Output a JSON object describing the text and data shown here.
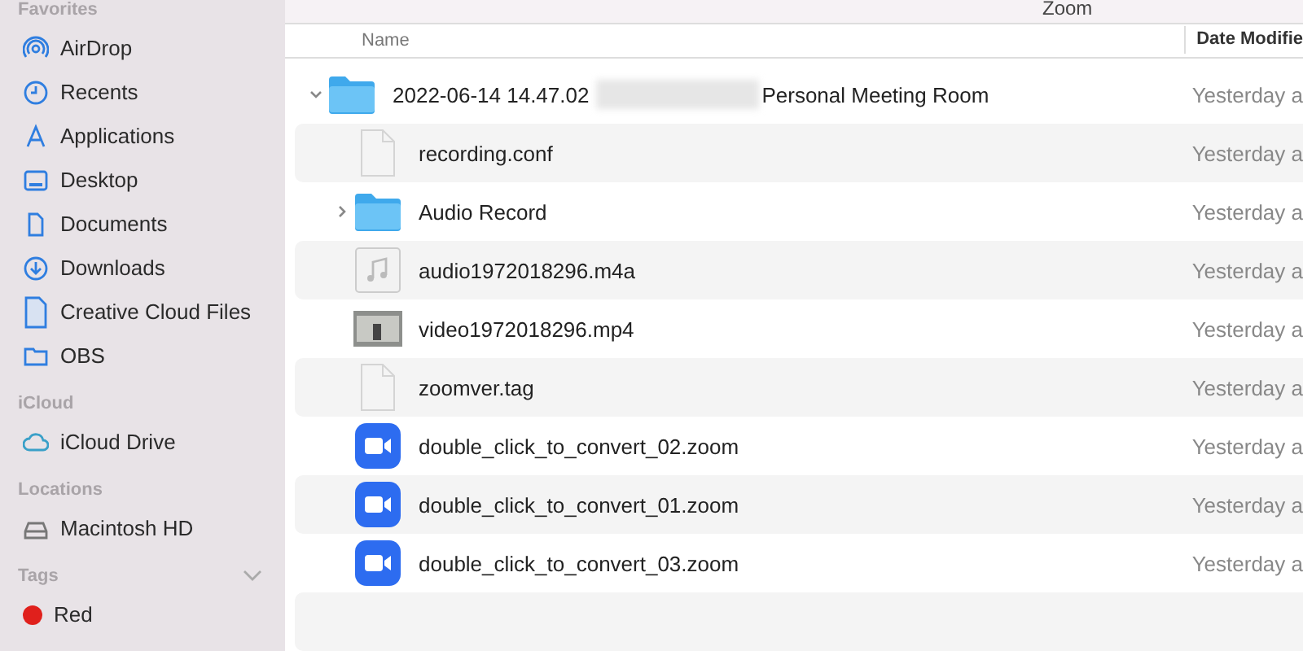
{
  "window": {
    "title": "Zoom"
  },
  "sidebar": {
    "sections": [
      {
        "title": "Favorites",
        "items": [
          {
            "label": "AirDrop",
            "kind": "airdrop"
          },
          {
            "label": "Recents",
            "kind": "recents"
          },
          {
            "label": "Applications",
            "kind": "applications"
          },
          {
            "label": "Desktop",
            "kind": "desktop"
          },
          {
            "label": "Documents",
            "kind": "documents"
          },
          {
            "label": "Downloads",
            "kind": "downloads"
          },
          {
            "label": "Creative Cloud Files",
            "kind": "file"
          },
          {
            "label": "OBS",
            "kind": "folder"
          }
        ]
      },
      {
        "title": "iCloud",
        "items": [
          {
            "label": "iCloud Drive",
            "kind": "cloud"
          }
        ]
      },
      {
        "title": "Locations",
        "items": [
          {
            "label": "Macintosh HD",
            "kind": "disk"
          }
        ]
      },
      {
        "title": "Tags",
        "expanded": true,
        "items": [
          {
            "label": "Red",
            "kind": "tag",
            "color": "#e0201c"
          }
        ]
      }
    ]
  },
  "table": {
    "columns": [
      "Name",
      "Date Modifie"
    ],
    "rows": [
      {
        "kind": "folder",
        "name": "2022-06-14 14.47.02",
        "redacted": true,
        "name_after": "Personal Meeting Room",
        "date": "Yesterday a",
        "expanded": true,
        "children": [
          {
            "kind": "document",
            "name": "recording.conf",
            "date": "Yesterday a"
          },
          {
            "kind": "folder",
            "name": "Audio Record",
            "date": "Yesterday a",
            "expanded": false
          },
          {
            "kind": "audio",
            "name": "audio1972018296.m4a",
            "date": "Yesterday a"
          },
          {
            "kind": "video",
            "name": "video1972018296.mp4",
            "date": "Yesterday a"
          },
          {
            "kind": "document",
            "name": "zoomver.tag",
            "date": "Yesterday a"
          },
          {
            "kind": "zoom",
            "name": "double_click_to_convert_02.zoom",
            "date": "Yesterday a"
          },
          {
            "kind": "zoom",
            "name": "double_click_to_convert_01.zoom",
            "date": "Yesterday a"
          },
          {
            "kind": "zoom",
            "name": "double_click_to_convert_03.zoom",
            "date": "Yesterday a"
          }
        ]
      }
    ]
  }
}
